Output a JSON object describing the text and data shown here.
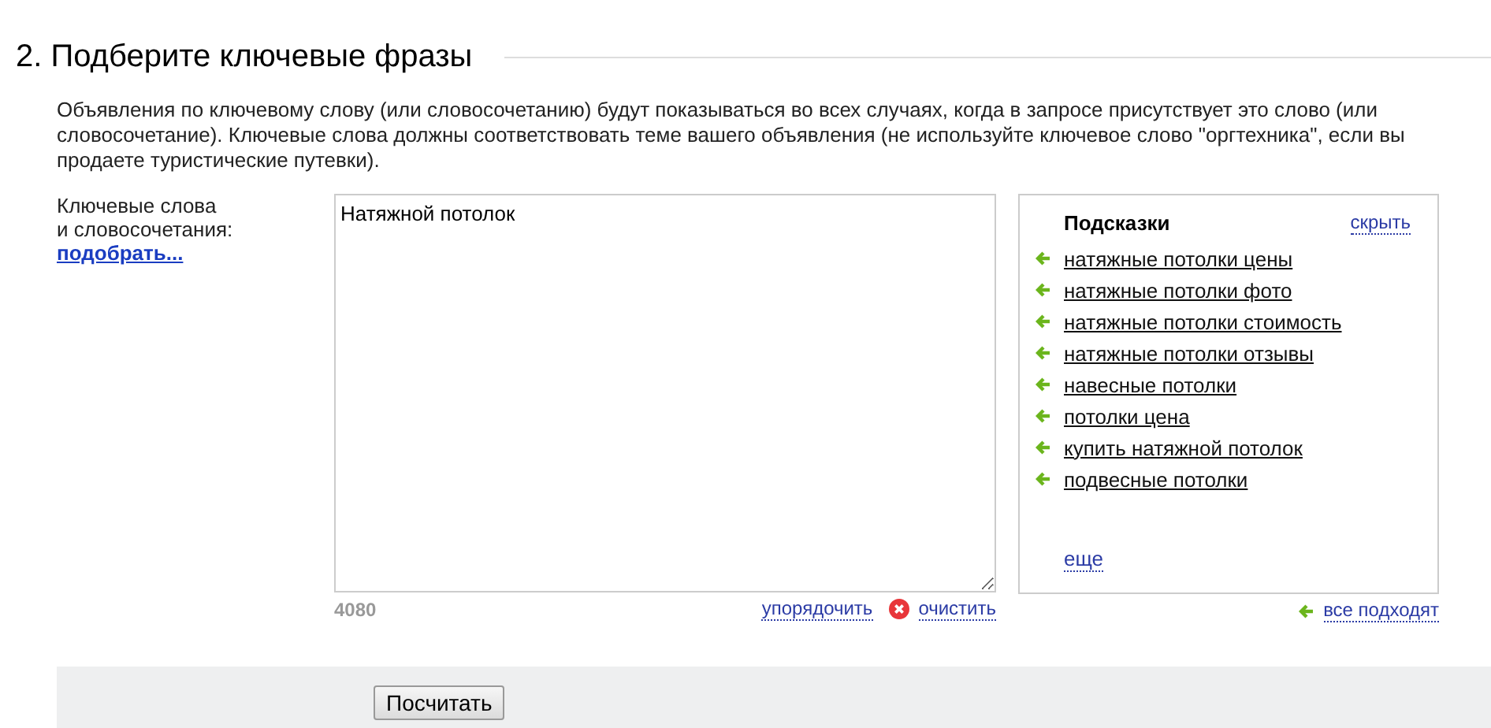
{
  "section_title": "2. Подберите ключевые фразы",
  "description": "Объявления по ключевому слову (или словосочетанию) будут показываться во всех случаях, когда в запросе присутствует это слово (или словосочетание). Ключевые слова должны соответствовать теме вашего объявления (не используйте ключевое слово \"оргтехника\", если вы продаете туристические путевки).",
  "field_label": {
    "lines": [
      "Ключевые слова",
      "и словосочетания:"
    ],
    "link": "подобрать..."
  },
  "keywords": {
    "value": "Натяжной потолок",
    "counter": "4080",
    "sort_link": "упорядочить",
    "clear_link": "очистить"
  },
  "hints": {
    "title": "Подсказки",
    "hide_link": "скрыть",
    "items": [
      "натяжные потолки цены",
      "натяжные потолки фото",
      "натяжные потолки стоимость",
      "натяжные потолки отзывы",
      "навесные потолки",
      "потолки цена",
      "купить натяжной потолок",
      "подвесные потолки"
    ],
    "more_link": "еще",
    "all_link": "все подходят"
  },
  "buttons": [
    "Посчитать"
  ]
}
